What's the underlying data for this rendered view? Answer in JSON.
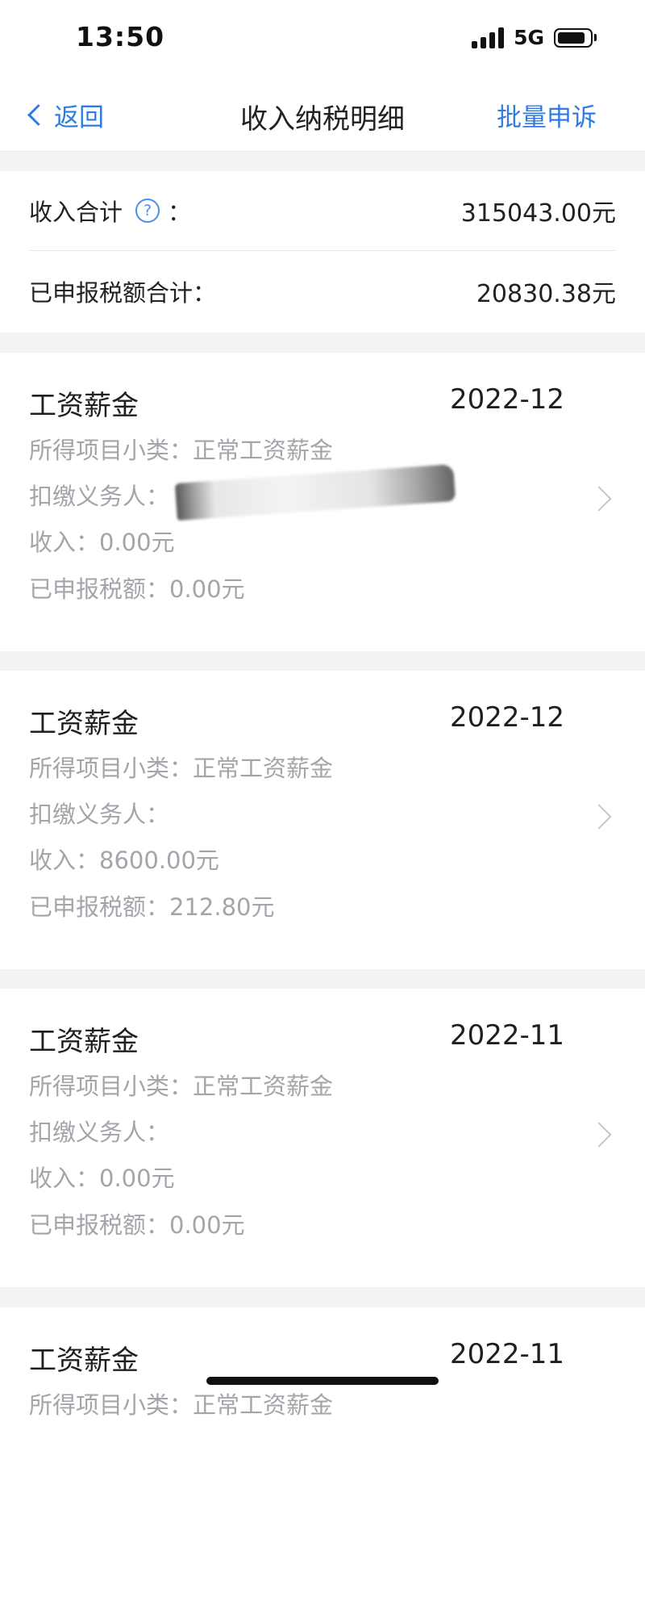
{
  "status_bar": {
    "time": "13:50",
    "network": "5G",
    "signal_icon": "signal-bars-icon",
    "battery_icon": "battery-icon"
  },
  "nav": {
    "back_label": "返回",
    "title": "收入纳税明细",
    "action_label": "批量申诉"
  },
  "summary": {
    "income_label": "收入合计",
    "income_colon": "：",
    "help_icon_glyph": "?",
    "income_value": "315043.00元",
    "tax_label": "已申报税额合计：",
    "tax_value": "20830.38元"
  },
  "records": [
    {
      "title": "工资薪金",
      "date": "2022-12",
      "subcategory": "所得项目小类：正常工资薪金",
      "withholder": "扣缴义务人：",
      "income": "收入：0.00元",
      "tax": "已申报税额：0.00元"
    },
    {
      "title": "工资薪金",
      "date": "2022-12",
      "subcategory": "所得项目小类：正常工资薪金",
      "withholder": "扣缴义务人：",
      "income": "收入：8600.00元",
      "tax": "已申报税额：212.80元"
    },
    {
      "title": "工资薪金",
      "date": "2022-11",
      "subcategory": "所得项目小类：正常工资薪金",
      "withholder": "扣缴义务人：",
      "income": "收入：0.00元",
      "tax": "已申报税额：0.00元"
    },
    {
      "title": "工资薪金",
      "date": "2022-11",
      "subcategory": "所得项目小类：正常工资薪金"
    }
  ],
  "colors": {
    "accent": "#2f7ce0",
    "muted_text": "#a3a5aa",
    "background": "#f2f3f5"
  }
}
